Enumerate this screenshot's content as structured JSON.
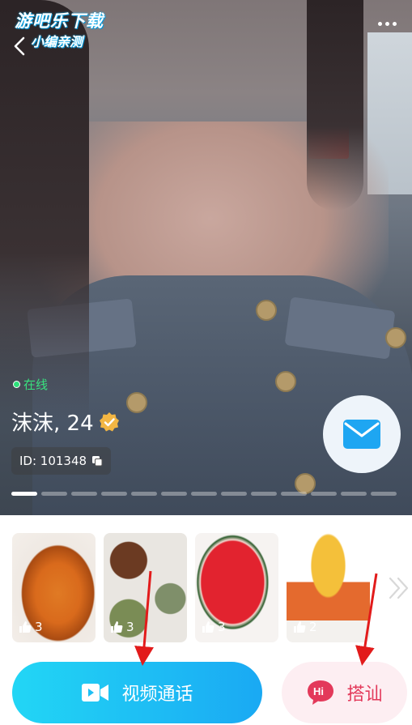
{
  "watermark": {
    "line1": "游吧乐下载",
    "line2": "小编亲测"
  },
  "profile": {
    "status": "在线",
    "name_age": "沫沫, 24",
    "id_text": "ID: 101348"
  },
  "gallery": {
    "likes": [
      "3",
      "3",
      "3",
      "2"
    ]
  },
  "actions": {
    "video_call": "视频通话",
    "chat_up": "搭讪"
  },
  "colors": {
    "online": "#39e27f",
    "verify_badge": "#f3b643",
    "video_gradient_start": "#22d6f5",
    "video_gradient_end": "#1aa9f3",
    "hi_accent": "#e3395a",
    "annotation_arrow": "#e21b1b"
  },
  "icons": {
    "back": "back-chevron-icon",
    "more": "more-dots-icon",
    "verify": "verified-badge-icon",
    "copy": "copy-icon",
    "mail": "mail-icon",
    "like": "thumbs-up-icon",
    "video": "video-camera-icon",
    "hi": "hi-bubble-icon",
    "next": "double-chevron-right-icon"
  }
}
